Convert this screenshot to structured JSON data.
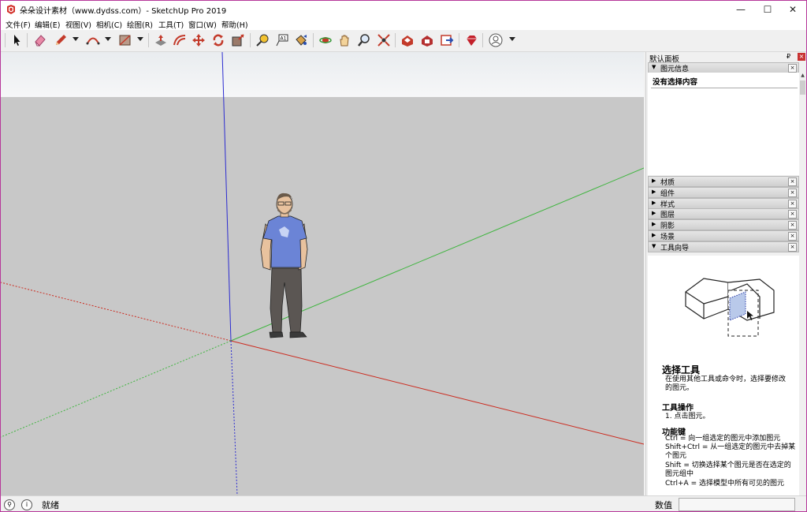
{
  "window": {
    "title": "朵朵设计素材（www.dydss.com）- SketchUp Pro 2019",
    "minimize_label": "—",
    "maximize_label": "☐",
    "close_label": "✕"
  },
  "menu": [
    "文件(F)",
    "编辑(E)",
    "视图(V)",
    "相机(C)",
    "绘图(R)",
    "工具(T)",
    "窗口(W)",
    "帮助(H)"
  ],
  "toolbar": {
    "tools": [
      "select-tool-icon",
      "eraser-tool-icon",
      "pencil-tool-icon",
      "arc-tool-icon",
      "shape-tool-icon",
      "push-pull-icon",
      "offset-icon",
      "move-icon",
      "rotate-icon",
      "scale-icon",
      "tape-measure-icon",
      "text-icon",
      "paint-bucket-icon",
      "orbit-icon",
      "pan-icon",
      "zoom-icon",
      "zoom-extents-icon",
      "warehouse-icon",
      "extension-warehouse-icon",
      "send-to-layout-icon",
      "ruby-icon",
      "account-icon"
    ]
  },
  "tray": {
    "title": "默认面板",
    "pin_label": "₽",
    "close_label": "×",
    "entity_info": {
      "label": "图元信息",
      "message": "没有选择内容"
    },
    "panels": [
      "材质",
      "组件",
      "样式",
      "图层",
      "阴影",
      "场景"
    ],
    "instructor": {
      "label": "工具向导",
      "title": "选择工具",
      "desc": "在使用其他工具或命令时，选择要修改的图元。",
      "ops_title": "工具操作",
      "ops": [
        "1. 点击图元。"
      ],
      "keys_title": "功能键",
      "keys": [
        "Ctrl = 向一组选定的图元中添加图元",
        "Shift+Ctrl = 从一组选定的图元中去掉某个图元",
        "Shift = 切换选择某个图元是否在选定的图元组中",
        "Ctrl+A = 选择模型中所有可见的图元"
      ]
    }
  },
  "status": {
    "text": "就绪",
    "measure_label": "数值",
    "measure_value": ""
  },
  "colors": {
    "red_axis": "#cc2a1e",
    "green_axis": "#3fb53f",
    "blue_axis": "#2b2bd0",
    "ground": "#c8c8c8",
    "sky": "#eef0f2"
  }
}
